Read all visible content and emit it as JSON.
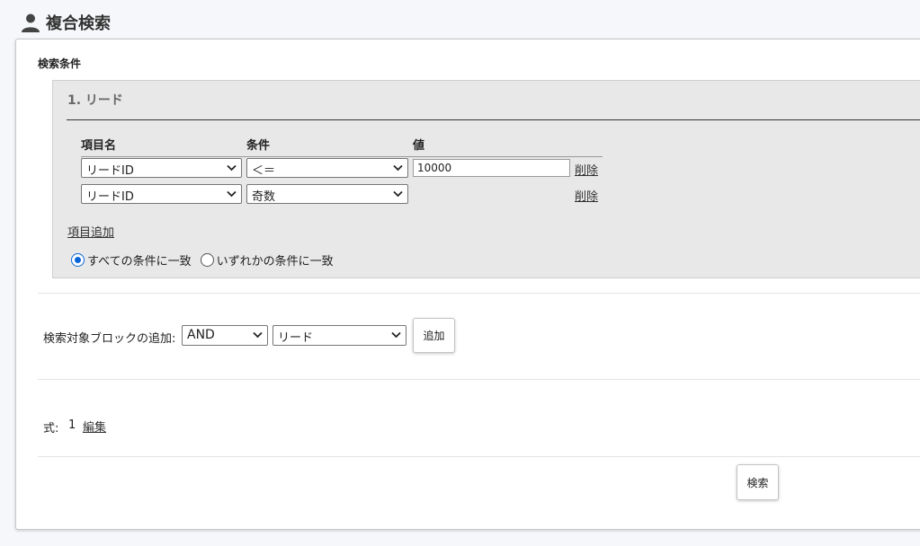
{
  "header": {
    "title": "複合検索",
    "icon": "person-icon"
  },
  "criteria": {
    "label": "検索条件",
    "block": {
      "title": "1. リード",
      "columns": {
        "item": "項目名",
        "condition": "条件",
        "value": "値"
      },
      "rows": [
        {
          "item": "リードID",
          "condition": "＜＝",
          "value": "10000",
          "delete_label": "削除"
        },
        {
          "item": "リードID",
          "condition": "奇数",
          "value": "",
          "delete_label": "削除"
        }
      ],
      "add_item_label": "項目追加",
      "match_all_label": "すべての条件に一致",
      "match_any_label": "いずれかの条件に一致",
      "match_mode": "all"
    }
  },
  "add_block": {
    "label": "検索対象ブロックの追加:",
    "operator": "AND",
    "target": "リード",
    "button_label": "追加"
  },
  "formula": {
    "label": "式:",
    "value": "1",
    "edit_label": "編集"
  },
  "search_button_label": "検索",
  "colors": {
    "radio_accent": "#0a66d8",
    "block_bg": "#e8e8e8"
  }
}
